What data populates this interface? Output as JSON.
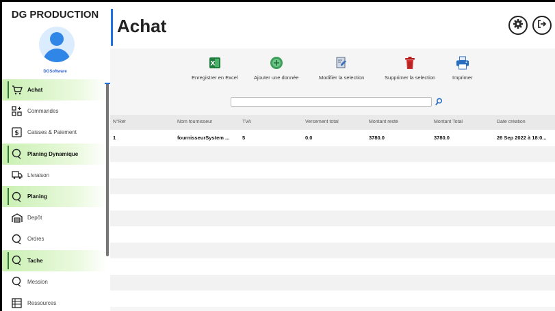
{
  "sidebar": {
    "brand": "DG PRODUCTION",
    "subtitle": "DGSoftware",
    "items": [
      {
        "label": "Achat",
        "icon": "cart-icon",
        "active": true
      },
      {
        "label": "Commandes",
        "icon": "grid-plus-icon",
        "active": false
      },
      {
        "label": "Caisses & Paiement",
        "icon": "dollar-icon",
        "active": false
      },
      {
        "label": "Planing Dynamique",
        "icon": "chat-icon",
        "active": true
      },
      {
        "label": "Livraison",
        "icon": "truck-icon",
        "active": false
      },
      {
        "label": "Planing",
        "icon": "chat-icon",
        "active": true
      },
      {
        "label": "Depôt",
        "icon": "warehouse-icon",
        "active": false
      },
      {
        "label": "Ordres",
        "icon": "chat-icon",
        "active": false
      },
      {
        "label": "Tache",
        "icon": "chat-icon",
        "active": true
      },
      {
        "label": "Mession",
        "icon": "chat-icon",
        "active": false
      },
      {
        "label": "Ressources",
        "icon": "table-icon",
        "active": false
      }
    ]
  },
  "header": {
    "title": "Achat",
    "settings_icon": "gear-icon",
    "logout_icon": "logout-icon"
  },
  "toolbar": {
    "excel": "Enregistrer en Excel",
    "add": "Ajouter une donnée",
    "edit": "Modifier la selection",
    "delete": "Supprimer la selection",
    "print": "Imprimer"
  },
  "search": {
    "placeholder": ""
  },
  "table": {
    "columns": [
      "N°Ref",
      "Nom fournisseur",
      "TVA",
      "Versement total",
      "Montant resté",
      "Montant Total",
      "Date création"
    ],
    "rows": [
      [
        "1",
        "fournisseurSystem ...",
        "5",
        "0.0",
        "3780.0",
        "3780.0",
        "26 Sep 2022 à 18:0..."
      ]
    ]
  },
  "colors": {
    "accent": "#1a73e8",
    "active_green": "#c9f0b2",
    "excel_green": "#1e7d3c",
    "delete_red": "#d32f2f"
  }
}
